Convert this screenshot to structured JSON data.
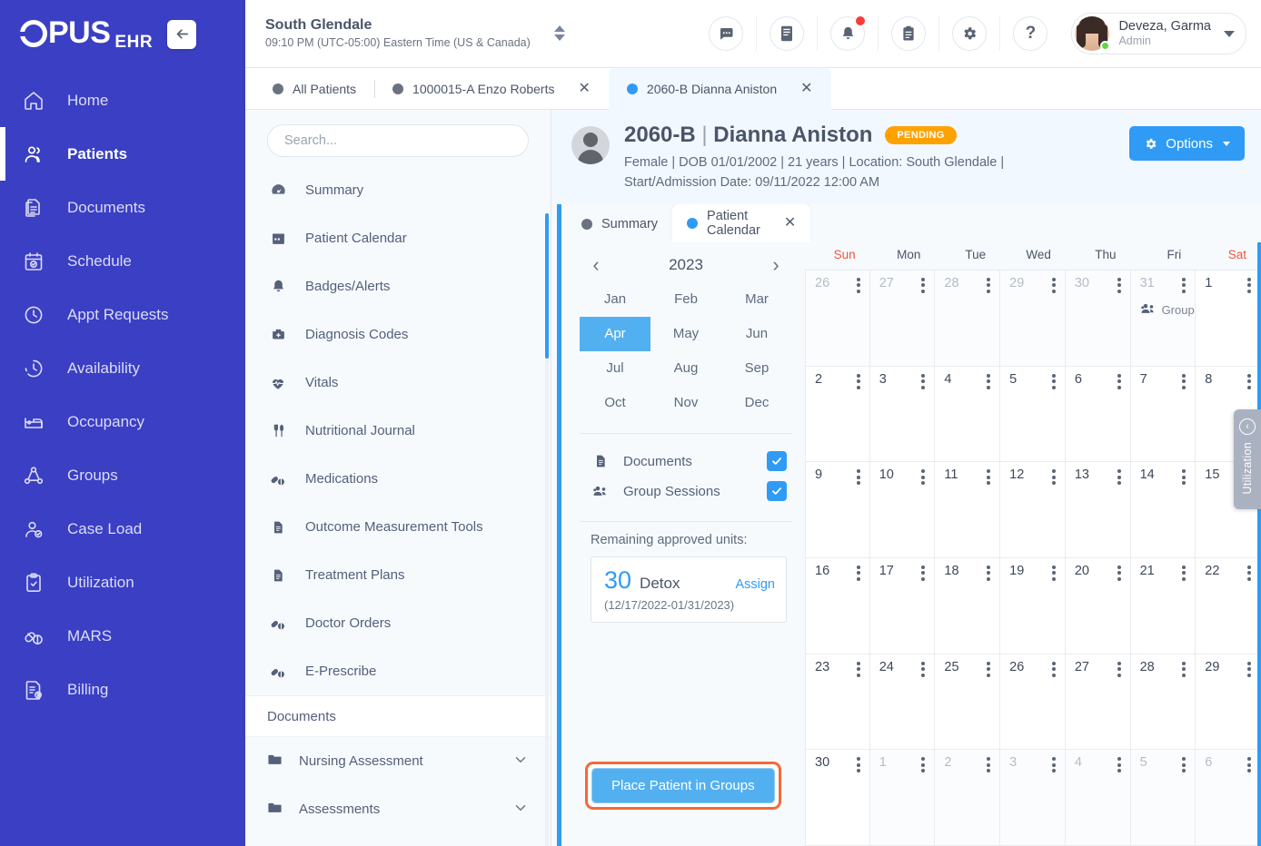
{
  "brand": {
    "logo_text": "PUS",
    "logo_suffix": "EHR",
    "collapse_icon": "arrow-left-icon"
  },
  "nav": {
    "items": [
      {
        "label": "Home",
        "icon": "home-icon",
        "active": false
      },
      {
        "label": "Patients",
        "icon": "users-icon",
        "active": true
      },
      {
        "label": "Documents",
        "icon": "documents-icon",
        "active": false
      },
      {
        "label": "Schedule",
        "icon": "calendar-check-icon",
        "active": false
      },
      {
        "label": "Appt Requests",
        "icon": "clock-icon",
        "active": false
      },
      {
        "label": "Availability",
        "icon": "clock-dashed-icon",
        "active": false
      },
      {
        "label": "Occupancy",
        "icon": "bed-icon",
        "active": false
      },
      {
        "label": "Groups",
        "icon": "group-network-icon",
        "active": false
      },
      {
        "label": "Case Load",
        "icon": "user-check-icon",
        "active": false
      },
      {
        "label": "Utilization",
        "icon": "clipboard-check-icon",
        "active": false
      },
      {
        "label": "MARS",
        "icon": "pills-icon",
        "active": false
      },
      {
        "label": "Billing",
        "icon": "invoice-dollar-icon",
        "active": false
      }
    ]
  },
  "topbar": {
    "facility": "South Glendale",
    "time": "09:10 PM (UTC-05:00) Eastern Time (US & Canada)",
    "icons": [
      {
        "name": "chat-icon",
        "glyph": "💬"
      },
      {
        "name": "notes-icon",
        "glyph": "☰"
      },
      {
        "name": "bell-icon",
        "glyph": "🔔",
        "badge": true
      },
      {
        "name": "clipboard-icon",
        "glyph": "📋"
      },
      {
        "name": "gear-icon",
        "glyph": "⚙"
      },
      {
        "name": "help-icon",
        "glyph": "?"
      }
    ],
    "user": {
      "name": "Deveza, Garma",
      "role": "Admin"
    }
  },
  "patient_tabs": [
    {
      "label": "All Patients",
      "closable": false,
      "active": false,
      "dot": "gray"
    },
    {
      "label": "1000015-A Enzo Roberts",
      "closable": true,
      "active": false,
      "dot": "gray"
    },
    {
      "label": "2060-B Dianna Aniston",
      "closable": true,
      "active": true,
      "dot": "blue"
    }
  ],
  "patient_menu": {
    "search_placeholder": "Search...",
    "items": [
      {
        "label": "Summary",
        "icon": "gauge-icon"
      },
      {
        "label": "Patient Calendar",
        "icon": "calendar-icon"
      },
      {
        "label": "Badges/Alerts",
        "icon": "bell-icon"
      },
      {
        "label": "Diagnosis Codes",
        "icon": "medkit-icon"
      },
      {
        "label": "Vitals",
        "icon": "heartbeat-icon"
      },
      {
        "label": "Nutritional Journal",
        "icon": "utensils-icon"
      },
      {
        "label": "Medications",
        "icon": "pills-icon"
      },
      {
        "label": "Outcome Measurement Tools",
        "icon": "file-lines-icon"
      },
      {
        "label": "Treatment Plans",
        "icon": "file-lines-icon"
      },
      {
        "label": "Doctor Orders",
        "icon": "pills-icon"
      },
      {
        "label": "E-Prescribe",
        "icon": "capsules-icon"
      }
    ],
    "section_label": "Documents",
    "folders": [
      {
        "label": "Nursing Assessment",
        "icon": "folder-icon",
        "chevron": "chevron-down-icon"
      },
      {
        "label": "Assessments",
        "icon": "folder-icon",
        "chevron": "chevron-down-icon"
      }
    ]
  },
  "patient": {
    "id": "2060-B",
    "separator": "|",
    "name": "Dianna Aniston",
    "status": "PENDING",
    "meta_line1": "Female  |  DOB 01/01/2002  |  21 years  |  Location: South Glendale  |",
    "meta_line2": "Start/Admission Date: 09/11/2022 12:00 AM",
    "options_label": "Options"
  },
  "inner_tabs": [
    {
      "label": "Summary",
      "active": false,
      "dot": "gray",
      "closable": false
    },
    {
      "label": "Patient Calendar",
      "active": true,
      "dot": "blue",
      "closable": true
    }
  ],
  "calendar_side": {
    "year": "2023",
    "prev_icon": "chevron-left-icon",
    "next_icon": "chevron-right-icon",
    "months": [
      "Jan",
      "Feb",
      "Mar",
      "Apr",
      "May",
      "Jun",
      "Jul",
      "Aug",
      "Sep",
      "Oct",
      "Nov",
      "Dec"
    ],
    "selected_month": "Apr",
    "filters": [
      {
        "label": "Documents",
        "icon": "file-icon",
        "checked": true
      },
      {
        "label": "Group Sessions",
        "icon": "users-group-icon",
        "checked": true
      }
    ],
    "units_title": "Remaining approved units:",
    "units_count": "30",
    "units_type": "Detox",
    "units_assign": "Assign",
    "units_range": "(12/17/2022-01/31/2023)",
    "place_button": "Place Patient in Groups"
  },
  "calendar": {
    "day_headers": [
      "Sun",
      "Mon",
      "Tue",
      "Wed",
      "Thu",
      "Fri",
      "Sat"
    ],
    "weekend_indices": [
      0,
      6
    ],
    "weeks": [
      [
        {
          "day": "26",
          "other": true
        },
        {
          "day": "27",
          "other": true
        },
        {
          "day": "28",
          "other": true
        },
        {
          "day": "29",
          "other": true
        },
        {
          "day": "30",
          "other": true
        },
        {
          "day": "31",
          "other": true,
          "events": [
            {
              "label": "Group",
              "icon": "users-group-icon"
            }
          ]
        },
        {
          "day": "1",
          "other": false
        }
      ],
      [
        {
          "day": "2",
          "other": false
        },
        {
          "day": "3",
          "other": false
        },
        {
          "day": "4",
          "other": false
        },
        {
          "day": "5",
          "other": false
        },
        {
          "day": "6",
          "other": false
        },
        {
          "day": "7",
          "other": false
        },
        {
          "day": "8",
          "other": false
        }
      ],
      [
        {
          "day": "9",
          "other": false
        },
        {
          "day": "10",
          "other": false
        },
        {
          "day": "11",
          "other": false
        },
        {
          "day": "12",
          "other": false
        },
        {
          "day": "13",
          "other": false
        },
        {
          "day": "14",
          "other": false
        },
        {
          "day": "15",
          "other": false
        }
      ],
      [
        {
          "day": "16",
          "other": false
        },
        {
          "day": "17",
          "other": false
        },
        {
          "day": "18",
          "other": false
        },
        {
          "day": "19",
          "other": false
        },
        {
          "day": "20",
          "other": false
        },
        {
          "day": "21",
          "other": false
        },
        {
          "day": "22",
          "other": false
        }
      ],
      [
        {
          "day": "23",
          "other": false
        },
        {
          "day": "24",
          "other": false
        },
        {
          "day": "25",
          "other": false
        },
        {
          "day": "26",
          "other": false
        },
        {
          "day": "27",
          "other": false
        },
        {
          "day": "28",
          "other": false
        },
        {
          "day": "29",
          "other": false
        }
      ],
      [
        {
          "day": "30",
          "other": false
        },
        {
          "day": "1",
          "other": true
        },
        {
          "day": "2",
          "other": true
        },
        {
          "day": "3",
          "other": true
        },
        {
          "day": "4",
          "other": true
        },
        {
          "day": "5",
          "other": true
        },
        {
          "day": "6",
          "other": true
        }
      ]
    ]
  },
  "utilization_flap": {
    "label": "Utilization",
    "icon": "chevron-left-circle-icon"
  },
  "colors": {
    "brand_blue": "#3a3fc4",
    "accent_blue": "#2f9bf5",
    "status_orange": "#ffa200",
    "highlight_orange": "#f4693a",
    "weekend_red": "#f2533a"
  }
}
